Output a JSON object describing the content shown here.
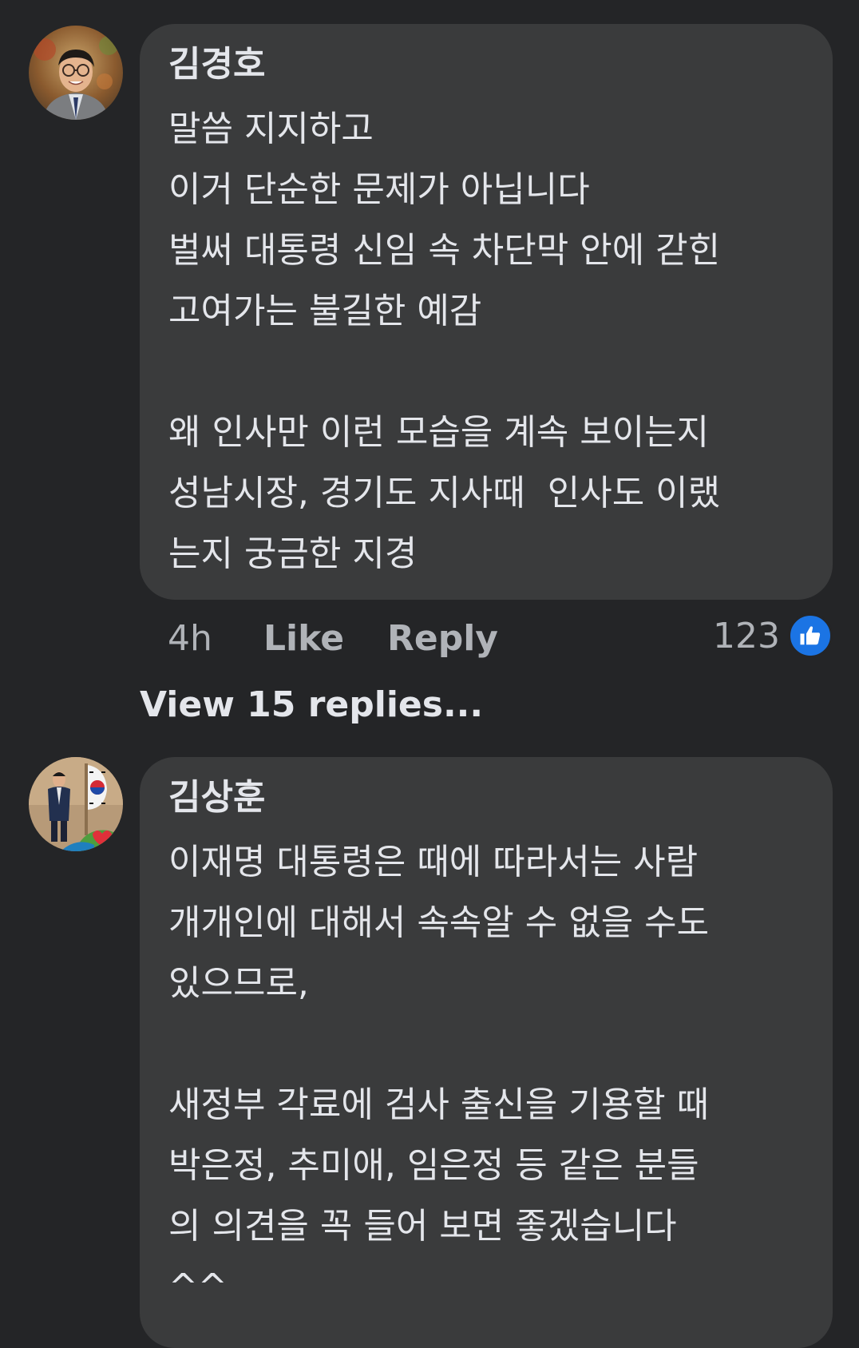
{
  "comments": [
    {
      "author": "김경호",
      "lines": [
        "말씀 지지하고",
        "이거 단순한 문제가 아닙니다",
        "벌써 대통령 신임 속 차단막 안에 갇힌",
        "고여가는 불길한 예감",
        "",
        "왜 인사만 이런 모습을 계속 보이는지",
        "성남시장, 경기도 지사때  인사도 이랬",
        "는지 궁금한 지경"
      ],
      "time": "4h",
      "like_label": "Like",
      "reply_label": "Reply",
      "reaction_count": "123",
      "reaction_icon": "thumbs-up-icon",
      "view_replies": "View 15 replies..."
    },
    {
      "author": "김상훈",
      "lines": [
        "이재명 대통령은 때에 따라서는 사람",
        "개개인에 대해서 속속알 수 없을 수도",
        "있으므로,",
        "",
        "새정부 각료에 검사 출신을 기용할 때",
        "박은정, 추미애, 임은정 등 같은 분들",
        "의 의견을 꼭 들어 보면 좋겠습니다",
        "^^"
      ]
    }
  ],
  "colors": {
    "background": "#242527",
    "bubble": "#3a3b3c",
    "text": "#e4e6eb",
    "muted": "#b0b3b8",
    "like_blue": "#1b74e4"
  }
}
